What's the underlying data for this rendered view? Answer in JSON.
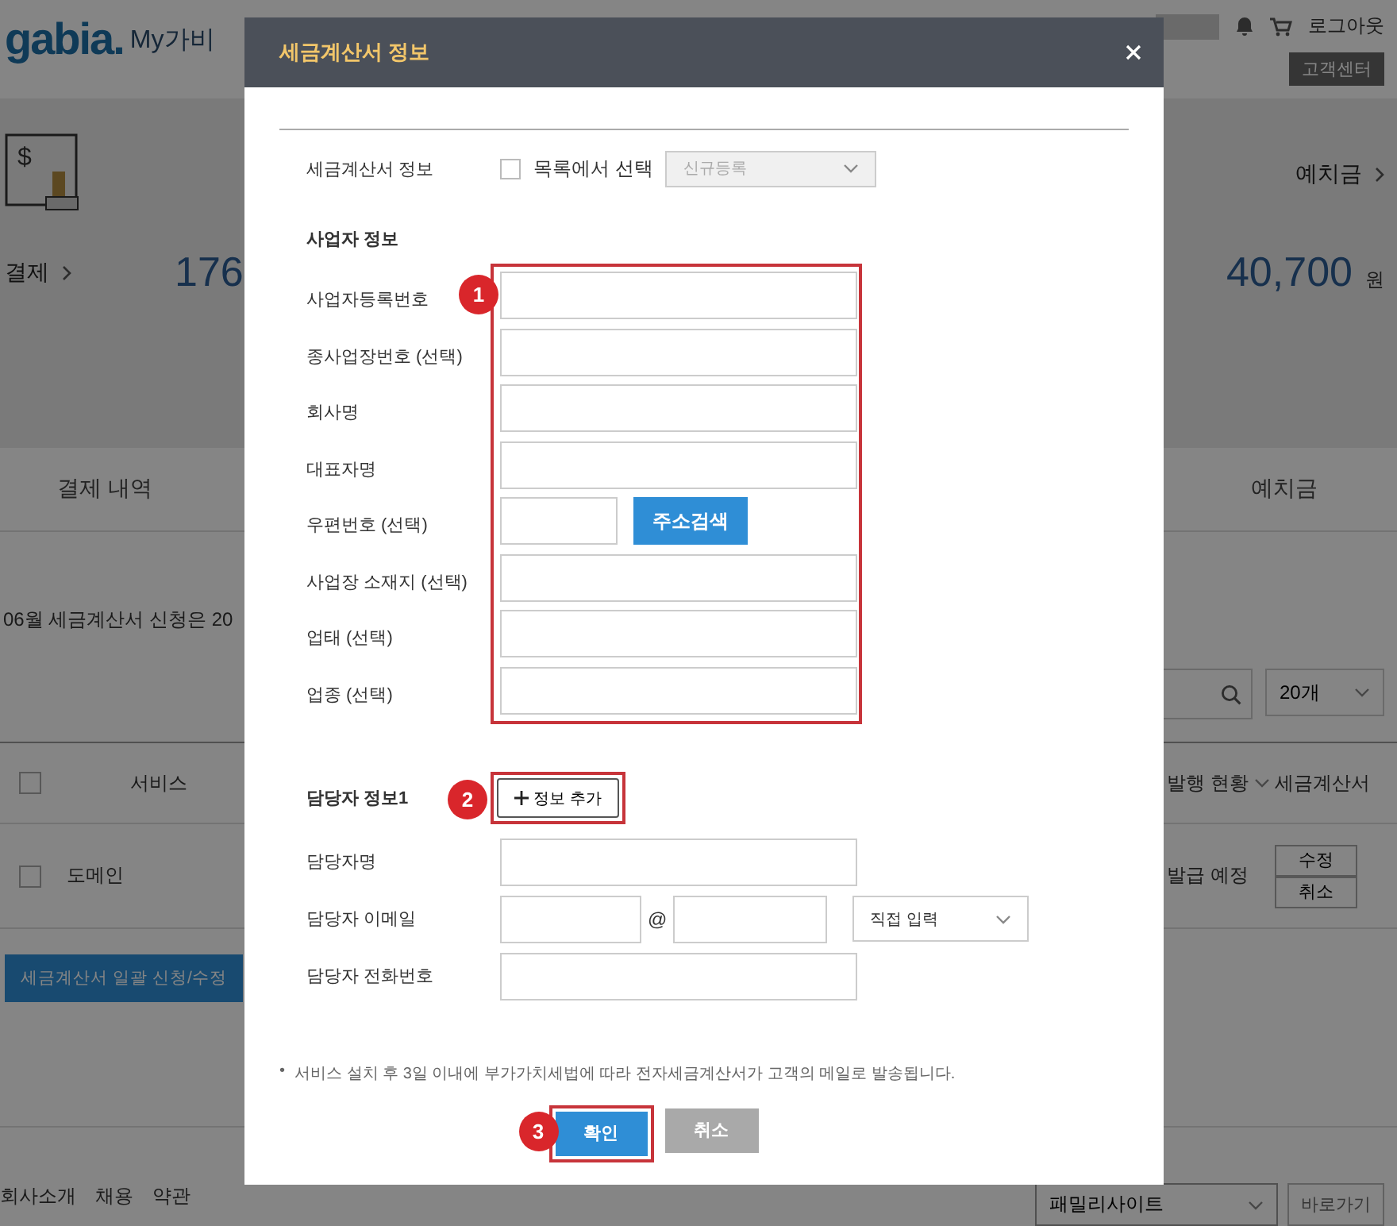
{
  "page": {
    "logo": "gabia.",
    "site_title": "My가비",
    "top_links": {
      "logout": "로그아웃",
      "support": "고객센터"
    },
    "summary": {
      "icon_symbol": "$",
      "deposit_link": "예치금",
      "payment_link": "결제",
      "payment_amount": "176",
      "deposit_amount": "40,700",
      "deposit_unit": "원"
    },
    "nav": [
      "결제 내역",
      "예치금"
    ],
    "notice": "06월 세금계산서 신청은 20",
    "page_size": "20개",
    "table": {
      "columns": [
        "서비스",
        "발행 현황",
        "세금계산서"
      ],
      "header_checked": false,
      "rows": [
        {
          "checked": false,
          "service": "도메인",
          "status": "발급 예정",
          "actions": [
            "수정",
            "취소"
          ]
        }
      ]
    },
    "bulk_button": "세금계산서 일괄 신청/수정",
    "footer": {
      "links": [
        "회사소개",
        "채용",
        "약관"
      ],
      "family_select": "패밀리사이트",
      "go_button": "바로가기"
    }
  },
  "dialog": {
    "title": "세금계산서 정보",
    "invoice_row": {
      "label": "세금계산서 정보",
      "checkbox_label": "목록에서 선택",
      "checked": false,
      "select_value": "신규등록",
      "select_disabled": true
    },
    "business_section": {
      "title": "사업자 정보",
      "marker": "1",
      "fields": [
        {
          "kind": "text",
          "label": "사업자등록번호"
        },
        {
          "kind": "text",
          "label": "종사업장번호 (선택)"
        },
        {
          "kind": "text",
          "label": "회사명"
        },
        {
          "kind": "text",
          "label": "대표자명"
        },
        {
          "kind": "postcode",
          "label": "우편번호 (선택)",
          "button": "주소검색"
        },
        {
          "kind": "text",
          "label": "사업장 소재지 (선택)"
        },
        {
          "kind": "text",
          "label": "업태 (선택)"
        },
        {
          "kind": "text",
          "label": "업종 (선택)"
        }
      ]
    },
    "contact_section": {
      "title": "담당자 정보1",
      "marker": "2",
      "add_button": "정보 추가",
      "fields": [
        {
          "kind": "text",
          "label": "담당자명"
        },
        {
          "kind": "email",
          "label": "담당자 이메일",
          "at": "@",
          "domain_select": "직접 입력"
        },
        {
          "kind": "text",
          "label": "담당자 전화번호"
        }
      ]
    },
    "note_bullet": "•",
    "note": "서비스 설치 후 3일 이내에 부가가치세법에 따라 전자세금계산서가 고객의 메일로 발송됩니다.",
    "confirm_marker": "3",
    "confirm_button": "확인",
    "cancel_button": "취소"
  }
}
